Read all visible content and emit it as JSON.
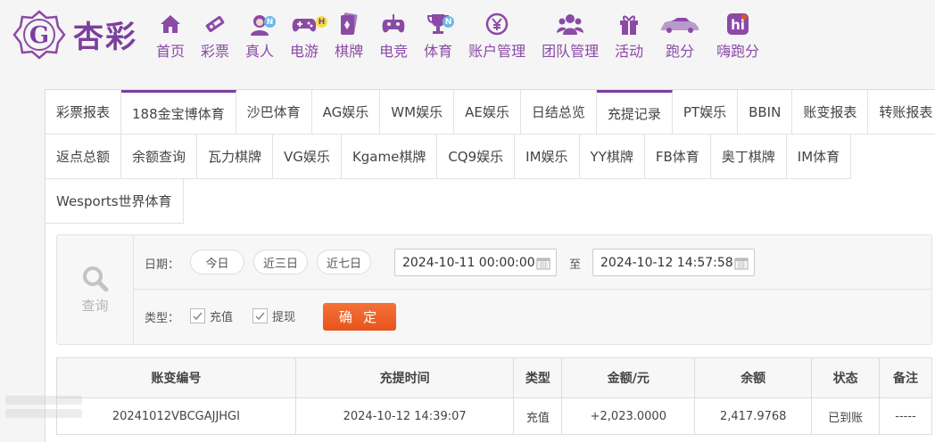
{
  "brand": {
    "name": "杏彩",
    "color": "#7b3f9e"
  },
  "nav": [
    {
      "label": "首页",
      "icon": "home-icon"
    },
    {
      "label": "彩票",
      "icon": "lottery-icon"
    },
    {
      "label": "真人",
      "icon": "live-dealer-icon",
      "badge": "N"
    },
    {
      "label": "电游",
      "icon": "gamepad-icon",
      "badge": "H"
    },
    {
      "label": "棋牌",
      "icon": "cards-icon"
    },
    {
      "label": "电竞",
      "icon": "esports-controller-icon"
    },
    {
      "label": "体育",
      "icon": "trophy-icon",
      "badge": "N"
    },
    {
      "label": "账户管理",
      "icon": "yen-coin-icon"
    },
    {
      "label": "团队管理",
      "icon": "team-icon"
    },
    {
      "label": "活动",
      "icon": "gift-icon"
    },
    {
      "label": "跑分",
      "icon": "car-icon"
    },
    {
      "label": "嗨跑分",
      "icon": "hi-app-icon"
    }
  ],
  "tabs": {
    "row1": [
      "彩票报表",
      "188金宝博体育",
      "沙巴体育",
      "AG娱乐",
      "WM娱乐",
      "AE娱乐",
      "日结总览",
      "充提记录",
      "PT娱乐",
      "BBIN",
      "账变报表",
      "转账报表"
    ],
    "row2": [
      "返点总额",
      "余额查询",
      "瓦力棋牌",
      "VG娱乐",
      "Kgame棋牌",
      "CQ9娱乐",
      "IM娱乐",
      "YY棋牌",
      "FB体育",
      "奥丁棋牌",
      "IM体育"
    ],
    "row3": [
      "Wesports世界体育"
    ],
    "active": "充提记录"
  },
  "query": {
    "side_label": "查询",
    "date_label": "日期：",
    "quick": [
      "今日",
      "近三日",
      "近七日"
    ],
    "start": "2024-10-11 00:00:00",
    "to_label": "至",
    "end": "2024-10-12 14:57:58",
    "type_label": "类型：",
    "types": [
      {
        "label": "充值",
        "checked": true
      },
      {
        "label": "提现",
        "checked": true
      }
    ],
    "confirm": "确 定"
  },
  "table": {
    "headers": [
      "账变编号",
      "充提时间",
      "类型",
      "金额/元",
      "余额",
      "状态",
      "备注"
    ],
    "rows": [
      [
        "20241012VBCGAJJHGI",
        "2024-10-12 14:39:07",
        "充值",
        "+2,023.0000",
        "2,417.9768",
        "已到账",
        "-----"
      ]
    ]
  }
}
